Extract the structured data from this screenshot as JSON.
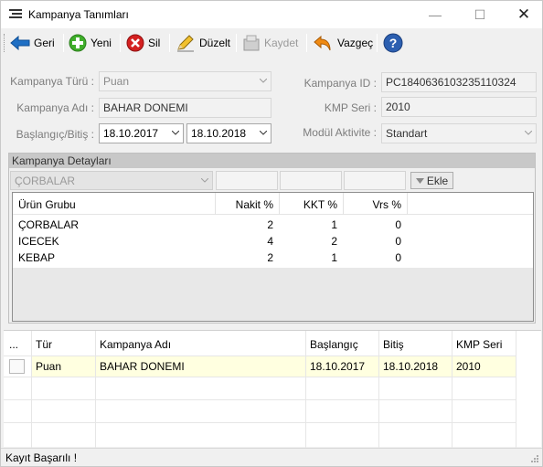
{
  "window": {
    "title": "Kampanya Tanımları"
  },
  "toolbar": {
    "back_label": "Geri",
    "new_label": "Yeni",
    "delete_label": "Sil",
    "edit_label": "Düzelt",
    "save_label": "Kaydet",
    "cancel_label": "Vazgeç"
  },
  "form": {
    "type_label": "Kampanya Türü :",
    "type_value": "Puan",
    "name_label": "Kampanya Adı :",
    "name_value": "BAHAR DONEMI",
    "dates_label": "Başlangıç/Bitiş :",
    "start_date": "18.10.2017",
    "end_date": "18.10.2018",
    "id_label": "Kampanya ID :",
    "id_value": "PC1840636103235110324",
    "kmp_label": "KMP Seri :",
    "kmp_value": "2010",
    "module_label": "Modül Aktivite :",
    "module_value": "Standart"
  },
  "details": {
    "header": "Kampanya Detayları",
    "combo_value": "ÇORBALAR",
    "add_label": "Ekle",
    "columns": [
      "Ürün Grubu",
      "Nakit %",
      "KKT %",
      "Vrs %"
    ],
    "rows": [
      [
        "ÇORBALAR",
        "2",
        "1",
        "0"
      ],
      [
        "ICECEK",
        "4",
        "2",
        "0"
      ],
      [
        "KEBAP",
        "2",
        "1",
        "0"
      ]
    ]
  },
  "grid": {
    "columns": [
      "...",
      "Tür",
      "Kampanya Adı",
      "Başlangıç",
      "Bitiş",
      "KMP Seri"
    ],
    "rows": [
      [
        "",
        "Puan",
        "BAHAR DONEMI",
        "18.10.2017",
        "18.10.2018",
        "2010"
      ]
    ]
  },
  "status": {
    "text": "Kayıt Başarılı !"
  },
  "colors": {
    "selected_row": "#ffffe0",
    "group_header": "#c8c8c8"
  }
}
